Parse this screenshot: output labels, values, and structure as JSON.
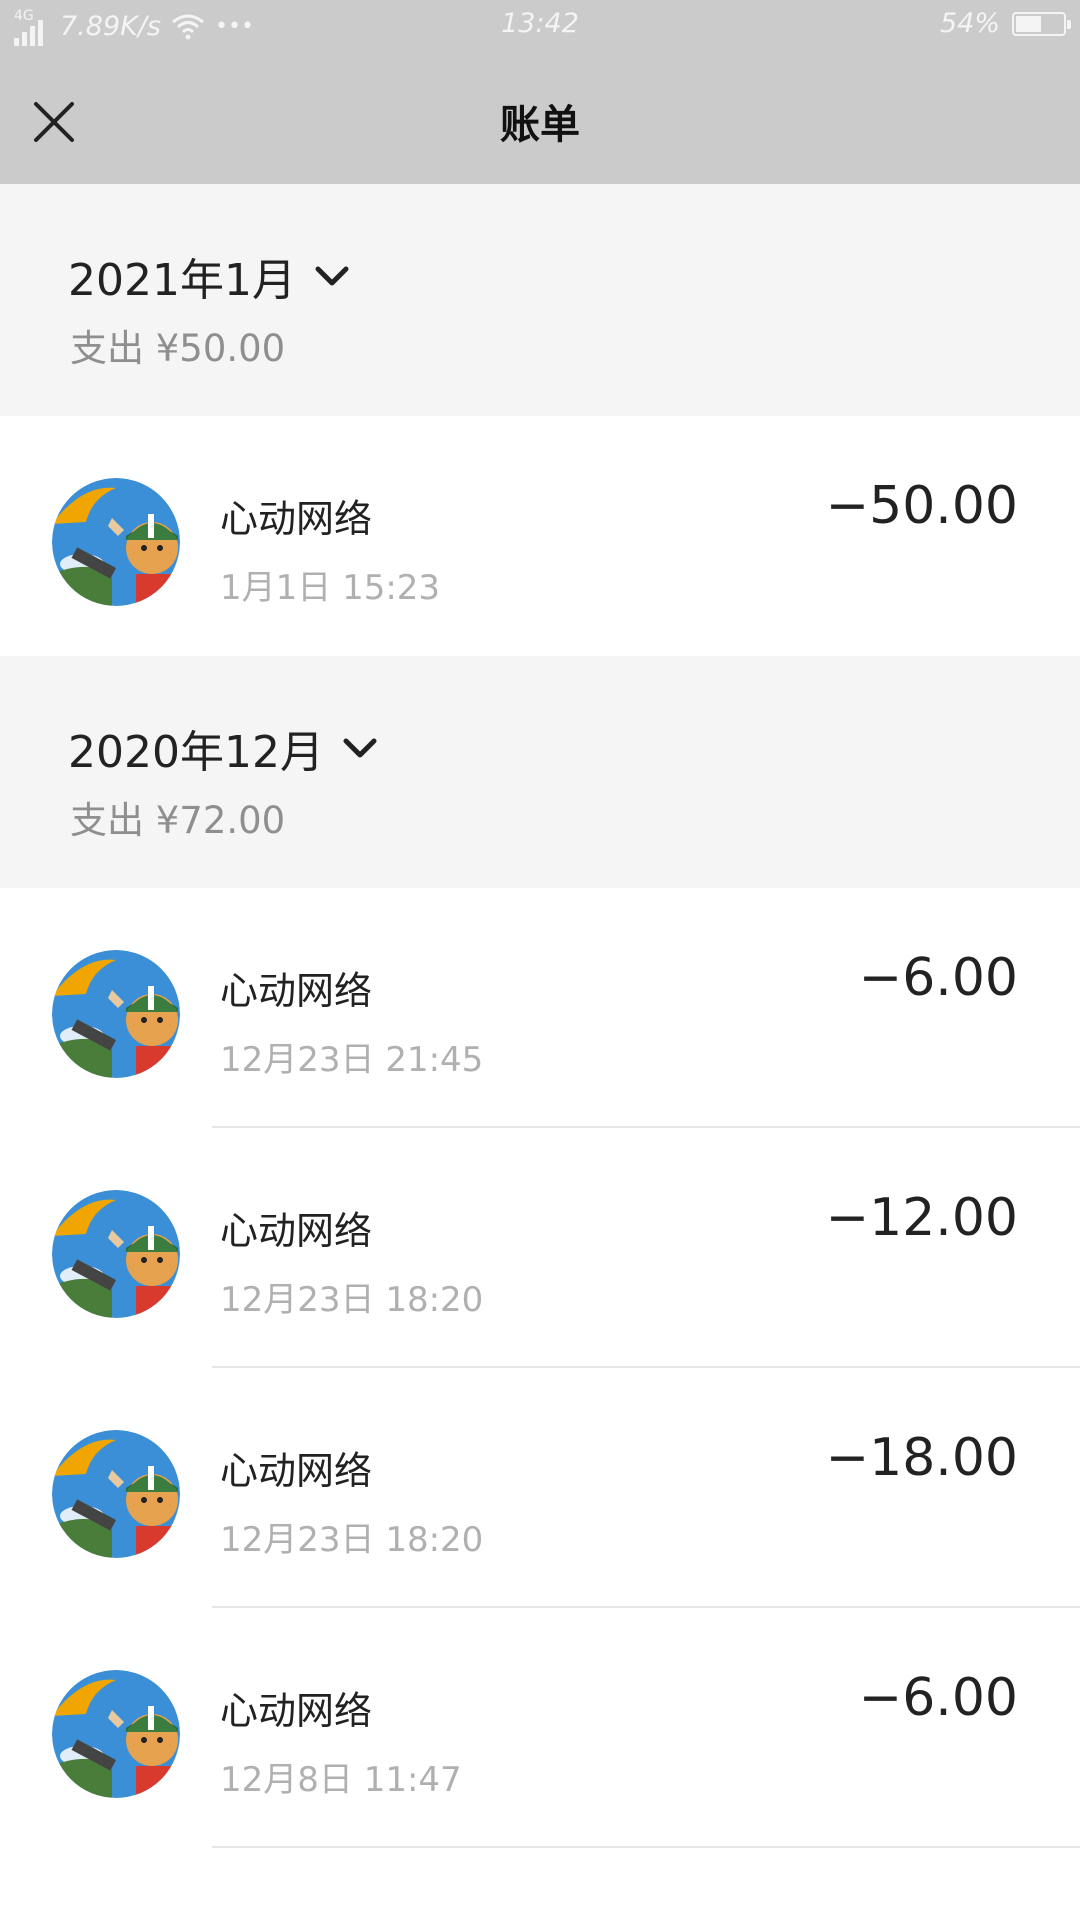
{
  "status_bar": {
    "network": "4G",
    "speed": "7.89K/s",
    "more": "•••",
    "time": "13:42",
    "battery_text": "54%",
    "battery_level": 0.54
  },
  "header": {
    "title": "账单"
  },
  "groups": [
    {
      "month": "2021年1月",
      "expense": "支出 ¥50.00",
      "transactions": [
        {
          "merchant": "心动网络",
          "time": "1月1日 15:23",
          "amount": "−50.00"
        }
      ]
    },
    {
      "month": "2020年12月",
      "expense": "支出 ¥72.00",
      "transactions": [
        {
          "merchant": "心动网络",
          "time": "12月23日 21:45",
          "amount": "−6.00"
        },
        {
          "merchant": "心动网络",
          "time": "12月23日 18:20",
          "amount": "−12.00"
        },
        {
          "merchant": "心动网络",
          "time": "12月23日 18:20",
          "amount": "−18.00"
        },
        {
          "merchant": "心动网络",
          "time": "12月8日 11:47",
          "amount": "−6.00"
        }
      ]
    }
  ]
}
